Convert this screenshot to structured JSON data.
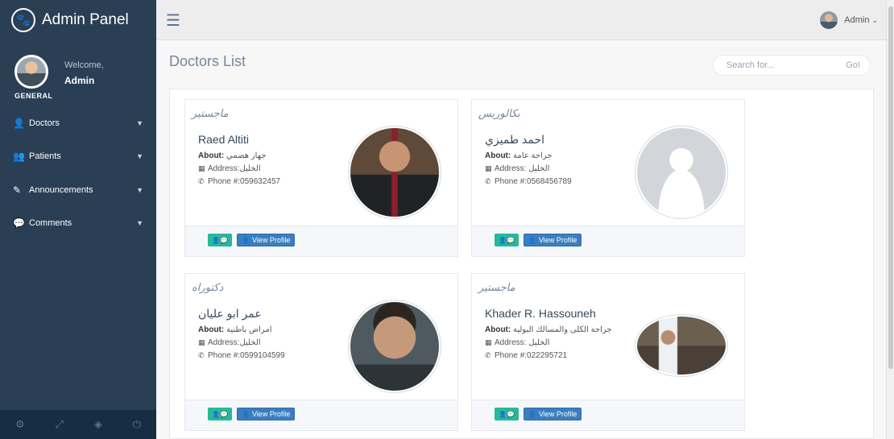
{
  "sidebar": {
    "brand": "Admin Panel",
    "welcome": "Welcome,",
    "user": "Admin",
    "section": "GENERAL",
    "items": [
      {
        "label": "Doctors",
        "icon": "user-icon"
      },
      {
        "label": "Patients",
        "icon": "users-icon"
      },
      {
        "label": "Announcements",
        "icon": "edit-icon"
      },
      {
        "label": "Comments",
        "icon": "comments-icon"
      }
    ],
    "footer_icons": [
      "settings-icon",
      "fullscreen-icon",
      "lock-icon",
      "power-icon"
    ]
  },
  "topbar": {
    "user": "Admin"
  },
  "page": {
    "title": "Doctors List"
  },
  "search": {
    "placeholder": "Search for...",
    "go": "Go!"
  },
  "labels": {
    "about": "About:",
    "address": "Address:",
    "phone": "Phone #:",
    "view_profile": "View Profile"
  },
  "doctors": [
    {
      "degree": "ماجستير",
      "name": "Raed Altiti",
      "about": "جهاز هضمي",
      "address": "الخليل",
      "phone": "059632457"
    },
    {
      "degree": "بكالوريس",
      "name": "احمد طميزي",
      "about": "جراحة عامة",
      "address": "الخليل",
      "phone": "0568456789"
    },
    {
      "degree": "دكتوراه",
      "name": "عمر ابو عليان",
      "about": "امراض باطنية",
      "address": "الخليل",
      "phone": "0599104599"
    },
    {
      "degree": "ماجستير",
      "name": "Khader R. Hassouneh",
      "about": "جراحة الكلى والمسالك البولية",
      "address": "الخليل",
      "phone": "022295721"
    }
  ],
  "colors": {
    "sidebar": "#2a3f54",
    "accent_green": "#26b99a",
    "accent_blue": "#3a7ec0"
  }
}
